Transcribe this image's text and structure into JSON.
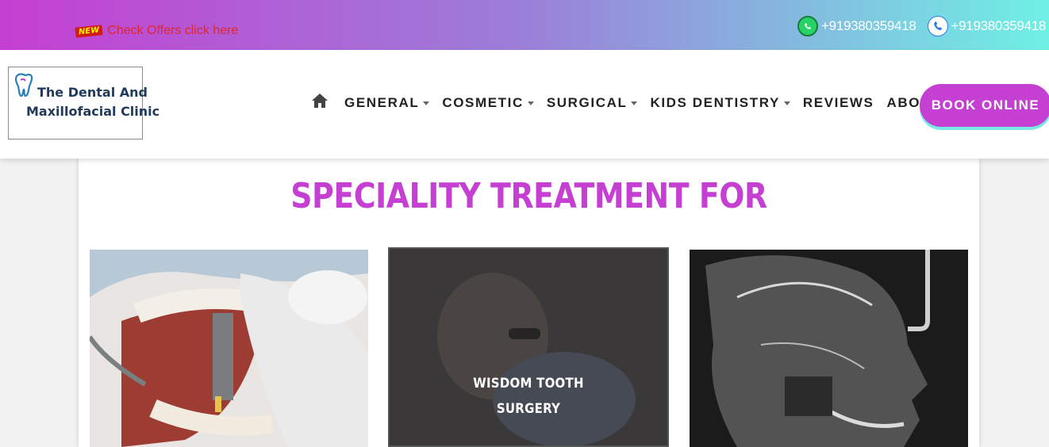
{
  "topbar": {
    "new_badge": "NEW",
    "offer_text": "Check Offers click here",
    "whatsapp_number": "+919380359418",
    "phone_number": "+919380359418"
  },
  "logo": {
    "line1": "The Dental And",
    "line2": "Maxillofacial Clinic"
  },
  "nav": {
    "items": [
      {
        "label": "GENERAL",
        "dropdown": true
      },
      {
        "label": "COSMETIC",
        "dropdown": true
      },
      {
        "label": "SURGICAL",
        "dropdown": true
      },
      {
        "label": "KIDS DENTISTRY",
        "dropdown": true
      },
      {
        "label": "REVIEWS",
        "dropdown": false
      },
      {
        "label": "ABOUT",
        "dropdown": true
      }
    ],
    "book_label": "BOOK ONLINE"
  },
  "section": {
    "title": "SPECIALITY TREATMENT FOR"
  },
  "cards": [
    {
      "label_line1": "",
      "label_line2": ""
    },
    {
      "label_line1": "WISDOM TOOTH",
      "label_line2": "SURGERY"
    },
    {
      "label_line1": "",
      "label_line2": ""
    }
  ],
  "colors": {
    "brand_purple": "#c53fd2",
    "accent_cyan": "#6ff0e4",
    "offer_red": "#e0262a"
  }
}
